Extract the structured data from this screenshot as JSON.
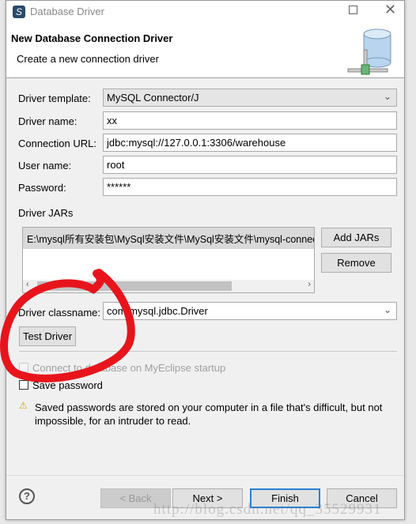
{
  "window": {
    "title": "Database Driver",
    "maximize_icon": "maximize-icon",
    "close_icon": "close-icon"
  },
  "header": {
    "title": "New Database Connection Driver",
    "subtitle": "Create a new connection driver"
  },
  "form": {
    "driver_template_label": "Driver template:",
    "driver_template_value": "MySQL Connector/J",
    "driver_name_label": "Driver name:",
    "driver_name_value": "xx",
    "connection_url_label": "Connection URL:",
    "connection_url_value": "jdbc:mysql://127.0.0.1:3306/warehouse",
    "user_name_label": "User name:",
    "user_name_value": "root",
    "password_label": "Password:",
    "password_value": "******"
  },
  "jars": {
    "label": "Driver JARs",
    "items": [
      "E:\\mysql所有安装包\\MySql安装文件\\MySql安装文件\\mysql-connector"
    ],
    "add_label": "Add JARs",
    "remove_label": "Remove"
  },
  "classname": {
    "label": "Driver classname:",
    "value": "com.mysql.jdbc.Driver"
  },
  "test_driver_label": "Test Driver",
  "options": {
    "connect_startup_label": "Connect to database on MyEclipse startup",
    "connect_startup_checked": false,
    "connect_startup_enabled": false,
    "save_password_label": "Save password",
    "save_password_checked": false
  },
  "warning": {
    "text": "Saved passwords are stored on your computer in a file that's difficult, but not impossible, for an intruder to read."
  },
  "footer": {
    "back_label": "< Back",
    "next_label": "Next >",
    "finish_label": "Finish",
    "cancel_label": "Cancel"
  },
  "watermark": "http://blog.csdn.net/qq_35529931",
  "colors": {
    "annotation": "#e8141c",
    "focus": "#2a7fd4"
  }
}
